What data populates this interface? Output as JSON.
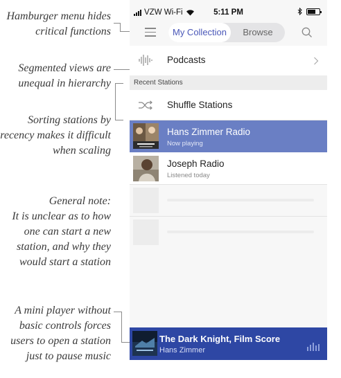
{
  "annotations": {
    "hamburger": [
      "Hamburger menu hides",
      "critical functions"
    ],
    "segmented": [
      "Segmented views are",
      "unequal in hierarchy"
    ],
    "sorting": [
      "Sorting stations by",
      "recency makes it difficult",
      "when scaling"
    ],
    "general": [
      "General note:",
      "It is unclear as to how",
      "one can start a new",
      "station, and why they",
      "would start a station"
    ],
    "mini_player": [
      "A mini player without",
      "basic controls forces",
      "users to open a station",
      "just to pause music"
    ]
  },
  "status_bar": {
    "carrier": "VZW Wi-Fi",
    "time": "5:11 PM",
    "icons": [
      "signal-icon",
      "wifi-icon",
      "bluetooth-icon",
      "battery-icon"
    ]
  },
  "nav": {
    "menu_icon": "hamburger-icon",
    "tabs": [
      {
        "label": "My Collection",
        "active": true
      },
      {
        "label": "Browse",
        "active": false
      }
    ],
    "search_icon": "search-icon"
  },
  "podcasts": {
    "label": "Podcasts",
    "icon": "soundwave-icon",
    "chevron": "chevron-right-icon"
  },
  "recent_section": {
    "header": "Recent Stations"
  },
  "shuffle": {
    "label": "Shuffle Stations",
    "icon": "shuffle-icon"
  },
  "stations": [
    {
      "name": "Hans Zimmer Radio",
      "status": "Now playing",
      "selected": true
    },
    {
      "name": "Joseph Radio",
      "status": "Listened today",
      "selected": false
    }
  ],
  "mini_player": {
    "title": "The Dark Knight, Film Score",
    "artist": "Hans Zimmer",
    "icon": "equalizer-icon"
  },
  "colors": {
    "accent": "#4a57b8",
    "selected_row": "#6a7fc4",
    "mini_player": "#2e47a4"
  }
}
